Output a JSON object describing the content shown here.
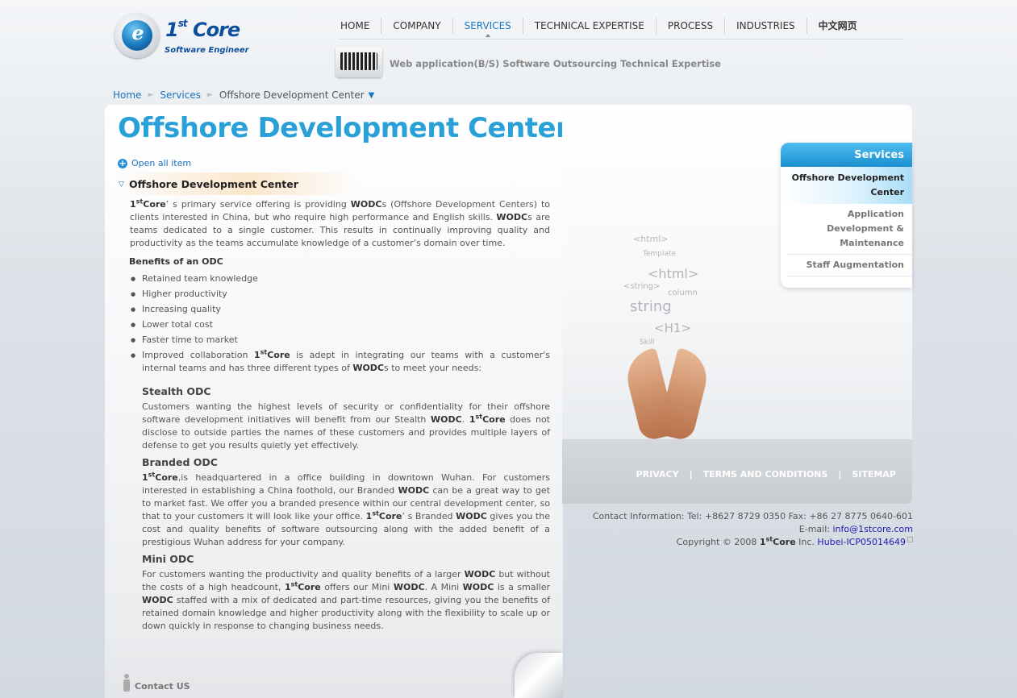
{
  "brand": {
    "logo_prefix": "1",
    "logo_sup": "st",
    "logo_word": "Core",
    "logo_subtitle": "Software Engineer",
    "logo_glyph": "e"
  },
  "nav": {
    "items": [
      "HOME",
      "COMPANY",
      "SERVICES",
      "TECHNICAL EXPERTISE",
      "PROCESS",
      "INDUSTRIES",
      "中文网页"
    ],
    "active": "SERVICES"
  },
  "tagline": "Web application(B/S) Software Outsourcing Technical Expertise",
  "breadcrumb": {
    "home": "Home",
    "services": "Services",
    "current": "Offshore Development Center"
  },
  "page": {
    "title": "Offshore Development Center",
    "open_all": "Open all item",
    "section_title": "Offshore Development Center",
    "intro": {
      "brand_prefix": "1",
      "brand_sup": "st",
      "brand_word": "Core",
      "t1": "’ s primary service offering is providing ",
      "wodc": "WODC",
      "t2": "s (Offshore Development Centers) to clients interested in China, but who require high performance and English skills. ",
      "t3": "s are teams dedicated to a single customer. This results in continually improving quality and productivity as the teams accumulate knowledge of a customer’s domain over time."
    },
    "benefits_heading": "Benefits of an ODC",
    "benefits": [
      "Retained team knowledge",
      "Higher productivity",
      "Increasing quality",
      "Lower total cost",
      "Faster time to market"
    ],
    "collab": {
      "t1": "Improved collaboration ",
      "t2": " is adept in integrating our teams with a customer's internal teams and has three different types of ",
      "t3": "s to meet your needs:"
    },
    "stealth": {
      "title": "Stealth ODC",
      "t1": "Customers wanting the highest levels of security or confidentiality for their offshore software development initiatives will benefit from our Stealth ",
      "t2": ". ",
      "t3": " does not disclose to outside parties the names of these customers and provides multiple layers of defense to get you results quietly yet effectively."
    },
    "branded": {
      "title": "Branded ODC",
      "t1": ",is headquartered in a office building in downtown Wuhan. For customers interested in establishing a China foothold, our Branded ",
      "t2": " can be a great way to get to market fast. We offer you a branded presence within our central development center, so that to your customers it will look like your office. ",
      "t3": "’ s Branded ",
      "t4": " gives you the cost and quality benefits of software outsourcing along with the added benefit of a prestigious Wuhan address for your company."
    },
    "mini": {
      "title": "Mini ODC",
      "t1": "For customers wanting the productivity and quality benefits of a larger ",
      "t2": " but without the costs of a high headcount, ",
      "t3": " offers our Mini ",
      "t4": ". A Mini ",
      "t5": " is a smaller ",
      "t6": " staffed with a mix of dedicated and part-time resources, giving you the benefits of retained domain knowledge and higher productivity along with the flexibility to scale up or down quickly in response to changing business needs."
    },
    "contact_us": "Contact US"
  },
  "image_words": [
    "<html>",
    "string",
    "<H1>",
    "<html>",
    "<string>",
    "Template",
    "column",
    "Skill"
  ],
  "services_menu": {
    "heading": "Services",
    "items": [
      {
        "label": "Offshore Development Center",
        "active": true
      },
      {
        "label": "Application Development & Maintenance",
        "active": false
      },
      {
        "label": "Staff Augmentation",
        "active": false
      }
    ]
  },
  "footer": {
    "links": [
      "PRIVACY",
      "TERMS AND CONDITIONS",
      "SITEMAP"
    ],
    "separator": "|",
    "contact_line": "Contact Information: Tel: +8627 8729 0350 Fax: +86 27 8775 0640-601",
    "email_label": "E-mail: ",
    "email": "info@1stcore.com",
    "copyright_prefix": "Copyright © 2008 ",
    "company_suffix": " Inc. ",
    "icp": "Hubei-ICP05014649"
  },
  "colors": {
    "accent": "#2aa0d8",
    "link": "#1a70bd",
    "nav_active": "#1a78c2",
    "menu_head": "#1b8fd0"
  }
}
